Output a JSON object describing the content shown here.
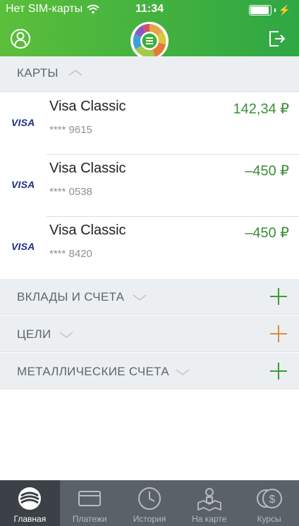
{
  "status_bar": {
    "carrier": "Нет SIM-карты",
    "time": "11:34"
  },
  "sections": {
    "cards": {
      "label": "КАРТЫ"
    },
    "deposits": {
      "label": "ВКЛАДЫ И СЧЕТА"
    },
    "goals": {
      "label": "ЦЕЛИ"
    },
    "metal": {
      "label": "МЕТАЛЛИЧЕСКИЕ СЧЕТА"
    }
  },
  "cards": [
    {
      "brand": "VISA",
      "name": "Visa Classic",
      "number": "**** 9615",
      "amount": "142,34 ₽"
    },
    {
      "brand": "VISA",
      "name": "Visa Classic",
      "number": "**** 0538",
      "amount": "–450 ₽"
    },
    {
      "brand": "VISA",
      "name": "Visa Classic",
      "number": "**** 8420",
      "amount": "–450 ₽"
    }
  ],
  "tabs": [
    {
      "label": "Главная",
      "icon": "sberbank-logo-icon",
      "active": true
    },
    {
      "label": "Платежи",
      "icon": "card-icon"
    },
    {
      "label": "История",
      "icon": "clock-icon"
    },
    {
      "label": "На карте",
      "icon": "map-person-icon"
    },
    {
      "label": "Курсы",
      "icon": "coins-icon"
    }
  ],
  "colors": {
    "brand_green": "#41b13f",
    "positive_amount": "#3c8d3a",
    "goal_plus": "#e08a3c",
    "tabbar": "#5a6167"
  }
}
